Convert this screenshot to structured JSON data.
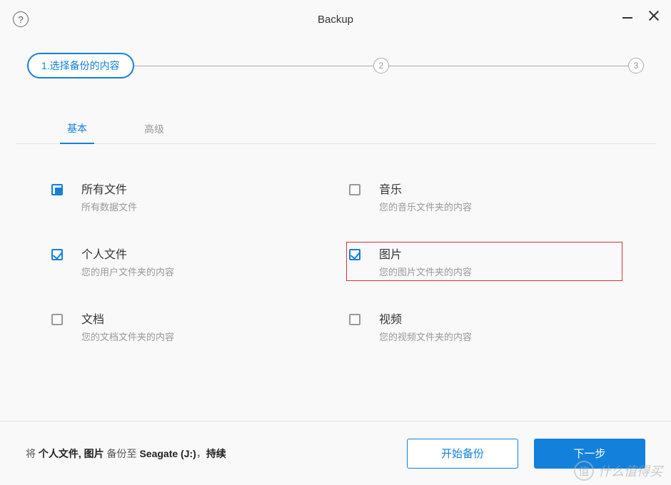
{
  "header": {
    "title": "Backup"
  },
  "stepper": {
    "active_label": "1.选择备份的内容",
    "step2": "2",
    "step3": "3"
  },
  "tabs": {
    "basic": "基本",
    "advanced": "高级"
  },
  "options": {
    "all_files": {
      "title": "所有文件",
      "desc": "所有数据文件",
      "state": "partial"
    },
    "music": {
      "title": "音乐",
      "desc": "您的音乐文件夹的内容",
      "state": "empty"
    },
    "personal": {
      "title": "个人文件",
      "desc": "您的用户文件夹的内容",
      "state": "checked"
    },
    "pictures": {
      "title": "图片",
      "desc": "您的图片文件夹的内容",
      "state": "checked"
    },
    "documents": {
      "title": "文档",
      "desc": "您的文档文件夹的内容",
      "state": "empty"
    },
    "videos": {
      "title": "视频",
      "desc": "您的视频文件夹的内容",
      "state": "empty"
    }
  },
  "footer": {
    "prefix": "将 ",
    "selected": "个人文件, 图片",
    "mid": " 备份至 ",
    "dest": "Seagate (J:)",
    "suffix1": "，",
    "suffix2": "持续",
    "start_label": "开始备份",
    "next_label": "下一步"
  },
  "watermark": {
    "badge": "值",
    "text": "什么值得买"
  }
}
